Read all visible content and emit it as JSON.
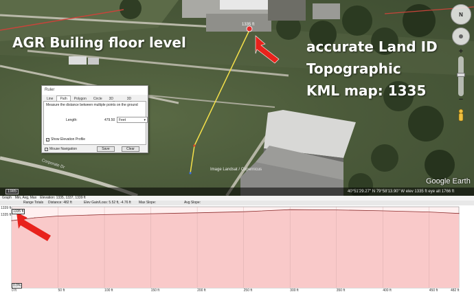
{
  "overlay": {
    "title_left": "AGR Builing floor level",
    "right_line_1": "accurate Land ID",
    "right_line_2": "Topographic",
    "right_line_3": "KML map: 1335"
  },
  "map": {
    "pin_label": "1335 ft",
    "image_credit": "Image Landsat / Copernicus",
    "road_label": "Corporate Dr",
    "logo": "Google Earth",
    "compass_label": "N"
  },
  "ruler": {
    "title": "Ruler",
    "tabs": [
      "Line",
      "Path",
      "Polygon",
      "Circle",
      "3D path",
      "3D polygon"
    ],
    "active_tab": "Path",
    "description": "Measure the distance between multiple points on the ground",
    "length_label": "Length:",
    "length_value": "479.50",
    "unit": "Feet",
    "show_elevation_label": "Show Elevation Profile",
    "show_elevation_checked": true,
    "mouse_navigation_label": "Mouse Navigation",
    "mouse_navigation_checked": true,
    "save_label": "Save",
    "clear_label": "Clear"
  },
  "status": {
    "year": "1985",
    "coords": "40°51'29.27\" N    79°58'13.90\" W   elev  1335 ft    eye alt  1766 ft"
  },
  "profile": {
    "bar1": [
      "Graph",
      "Min, Avg, Max",
      "Elevation: 1335, 1337, 1339 ft"
    ],
    "range_totals": "Range Totals",
    "distance": "Distance: 482 ft",
    "gain_loss": "Elev Gain/Loss: 5.52 ft, -4.76 ft",
    "max_slope": "Max Slope:",
    "avg_slope": "Avg Slope:",
    "y_top": "1339 ft",
    "y_mid": "1335 ft",
    "elev_tag": "1335 ft",
    "pct_tag": "0.0%",
    "x_labels": [
      "0 ft",
      "50 ft",
      "100 ft",
      "150 ft",
      "200 ft",
      "250 ft",
      "300 ft",
      "350 ft",
      "400 ft",
      "450 ft",
      "482 ft"
    ],
    "colors": {
      "fill": "#f9c9c9",
      "line": "#8a2a2a",
      "arrow": "#e8221c"
    }
  },
  "chart_data": {
    "type": "area",
    "xlabel": "",
    "ylabel": "",
    "x": [
      0,
      25,
      50,
      100,
      150,
      200,
      250,
      300,
      350,
      400,
      450,
      482
    ],
    "values": [
      1335.2,
      1336.2,
      1336.8,
      1337.3,
      1337.6,
      1337.9,
      1338.3,
      1339.0,
      1338.9,
      1338.6,
      1338.2,
      1337.7
    ],
    "xlim": [
      0,
      482
    ]
  }
}
